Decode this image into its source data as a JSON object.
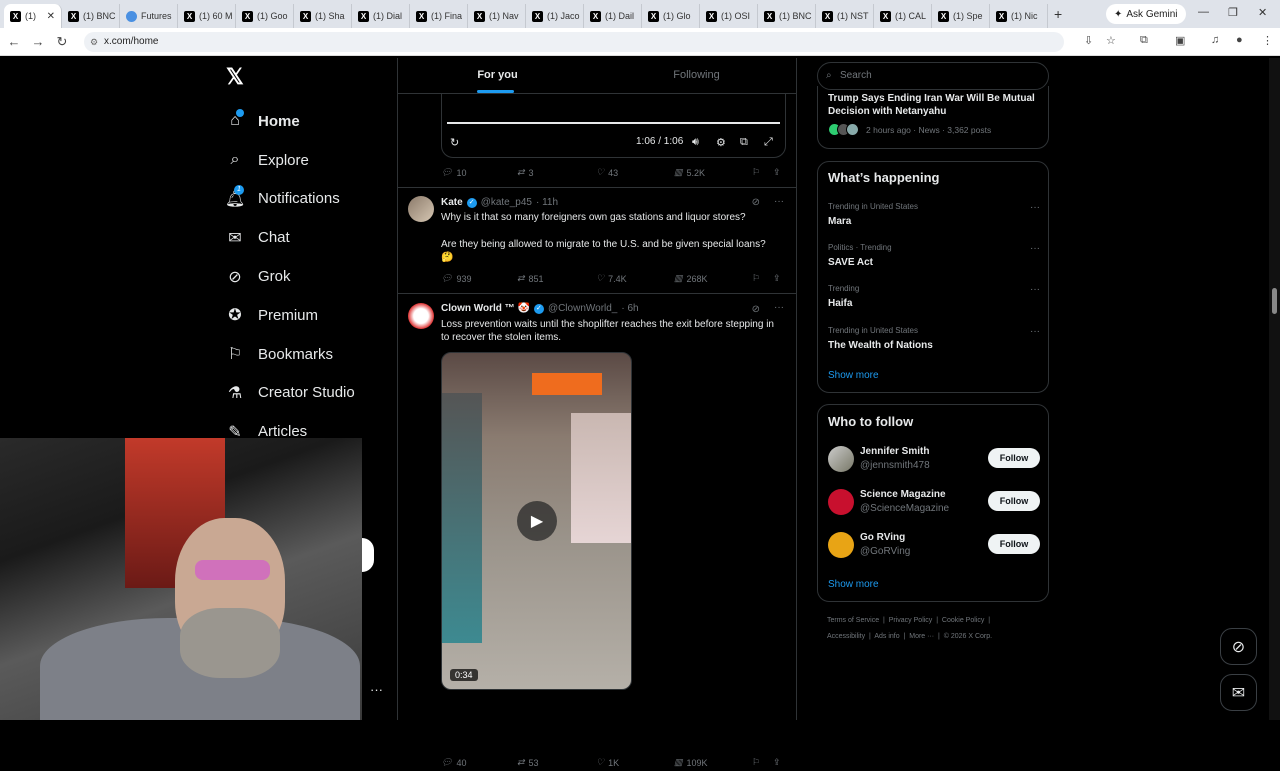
{
  "browser": {
    "tabs": [
      {
        "label": "(1)",
        "icon": "x-favicon",
        "active": true
      },
      {
        "label": "(1) BNC",
        "icon": "x-favicon"
      },
      {
        "label": "Futures",
        "icon": "blue-favicon"
      },
      {
        "label": "(1) 60 M",
        "icon": "x-favicon"
      },
      {
        "label": "(1) Goo",
        "icon": "x-favicon"
      },
      {
        "label": "(1) Sha",
        "icon": "x-favicon"
      },
      {
        "label": "(1) Dial",
        "icon": "x-favicon"
      },
      {
        "label": "(1) Fina",
        "icon": "x-favicon"
      },
      {
        "label": "(1) Nav",
        "icon": "x-favicon"
      },
      {
        "label": "(1) Jaco",
        "icon": "x-favicon"
      },
      {
        "label": "(1) Dail",
        "icon": "x-favicon"
      },
      {
        "label": "(1) Glo",
        "icon": "x-favicon"
      },
      {
        "label": "(1) OSI",
        "icon": "x-favicon"
      },
      {
        "label": "(1) BNC",
        "icon": "x-favicon"
      },
      {
        "label": "(1) NST",
        "icon": "x-favicon"
      },
      {
        "label": "(1) CAL",
        "icon": "x-favicon"
      },
      {
        "label": "(1) Spe",
        "icon": "x-favicon"
      },
      {
        "label": "(1) Nic",
        "icon": "x-favicon"
      }
    ],
    "gemini_label": "Ask Gemini",
    "url": "x.com/home"
  },
  "nav": {
    "logo": "𝕏",
    "items": [
      {
        "label": "Home",
        "icon": "home-icon"
      },
      {
        "label": "Explore",
        "icon": "search-icon"
      },
      {
        "label": "Notifications",
        "icon": "bell-icon",
        "badge": "1"
      },
      {
        "label": "Chat",
        "icon": "mail-icon"
      },
      {
        "label": "Grok",
        "icon": "grok-icon"
      },
      {
        "label": "Premium",
        "icon": "verified-icon"
      },
      {
        "label": "Bookmarks",
        "icon": "bookmark-icon"
      },
      {
        "label": "Creator Studio",
        "icon": "flask-icon"
      },
      {
        "label": "Articles",
        "icon": "article-icon"
      }
    ]
  },
  "feed": {
    "tabs": [
      "For you",
      "Following"
    ],
    "video_time": "1:06 / 1:06",
    "top_actions": {
      "replies": "10",
      "reposts": "3",
      "likes": "43",
      "views": "5.2K"
    },
    "posts": [
      {
        "name": "Kate",
        "handle": "@kate_p45",
        "time": "· 11h",
        "text1": "Why is it that so many foreigners own gas stations and liquor stores?",
        "text2": "Are they being allowed to migrate to the U.S. and be given special loans?",
        "emoji": "🤔",
        "replies": "939",
        "reposts": "851",
        "likes": "7.4K",
        "views": "268K"
      },
      {
        "name": "Clown World ™ 🤡",
        "handle": "@ClownWorld_",
        "time": "· 6h",
        "text1": "Loss prevention waits until the shoplifter reaches the exit before stepping in to recover the stolen items.",
        "duration": "0:34",
        "replies": "40",
        "reposts": "53",
        "likes": "1K",
        "views": "109K"
      }
    ]
  },
  "sidebar": {
    "search_placeholder": "Search",
    "news": {
      "title": "Trump Says Ending Iran War Will Be Mutual Decision with Netanyahu",
      "meta": "2 hours ago · News · 3,362 posts"
    },
    "happening": {
      "title": "What’s happening",
      "trends": [
        {
          "meta": "Trending in United States",
          "title": "Mara"
        },
        {
          "meta": "Politics · Trending",
          "title": "SAVE Act"
        },
        {
          "meta": "Trending",
          "title": "Haifa"
        },
        {
          "meta": "Trending in United States",
          "title": "The Wealth of Nations"
        }
      ],
      "show_more": "Show more"
    },
    "who_to_follow": {
      "title": "Who to follow",
      "accounts": [
        {
          "name": "Jennifer Smith",
          "handle": "@jennsmith478",
          "follow": "Follow"
        },
        {
          "name": "Science Magazine",
          "handle": "@ScienceMagazine",
          "follow": "Follow"
        },
        {
          "name": "Go RVing",
          "handle": "@GoRVing",
          "follow": "Follow"
        }
      ],
      "show_more": "Show more"
    },
    "footer": {
      "line1": [
        "Terms of Service",
        "Privacy Policy",
        "Cookie Policy"
      ],
      "line2": [
        "Accessibility",
        "Ads info",
        "More ···",
        "© 2026 X Corp."
      ]
    }
  },
  "colors": {
    "accent": "#1d9bf0",
    "background": "#000000",
    "border": "#2f3336",
    "muted": "#71767b"
  }
}
